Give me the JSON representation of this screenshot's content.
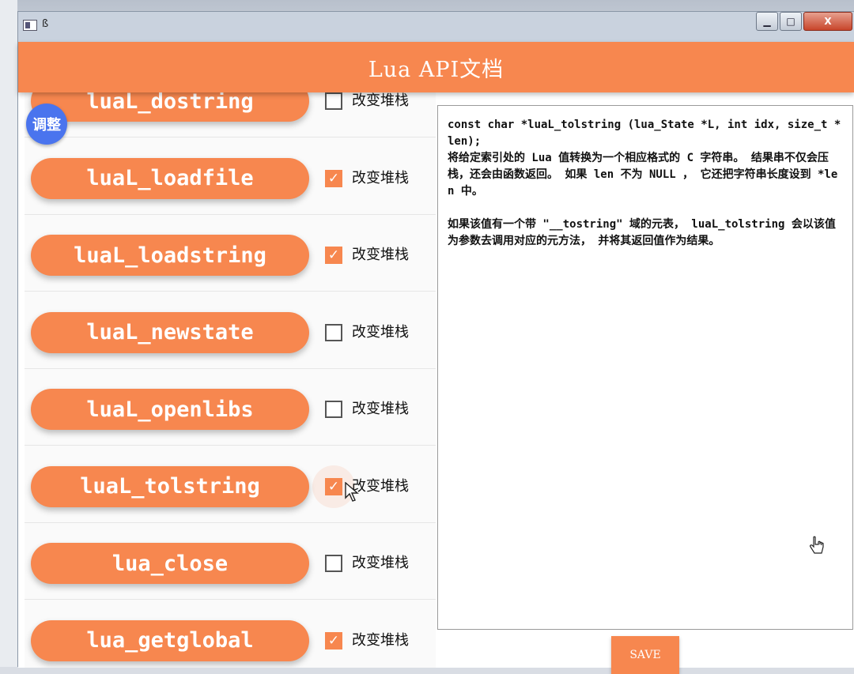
{
  "window": {
    "icon_glyph": "ß",
    "minimize": "▁",
    "maximize": "□",
    "close": "X"
  },
  "header": {
    "title": "Lua API文档"
  },
  "fab": {
    "label": "调整"
  },
  "list": {
    "items": [
      {
        "name": "luaL_dostring",
        "checked": false,
        "label": "改变堆栈"
      },
      {
        "name": "luaL_loadfile",
        "checked": true,
        "label": "改变堆栈"
      },
      {
        "name": "luaL_loadstring",
        "checked": true,
        "label": "改变堆栈"
      },
      {
        "name": "luaL_newstate",
        "checked": false,
        "label": "改变堆栈"
      },
      {
        "name": "luaL_openlibs",
        "checked": false,
        "label": "改变堆栈"
      },
      {
        "name": "luaL_tolstring",
        "checked": true,
        "label": "改变堆栈"
      },
      {
        "name": "lua_close",
        "checked": false,
        "label": "改变堆栈"
      },
      {
        "name": "lua_getglobal",
        "checked": true,
        "label": "改变堆栈"
      }
    ]
  },
  "doc": {
    "text": "const char *luaL_tolstring (lua_State *L, int idx, size_t *len);\n将给定索引处的 Lua 值转换为一个相应格式的 C 字符串。 结果串不仅会压栈，还会由函数返回。 如果 len 不为 NULL ， 它还把字符串长度设到 *len 中。\n\n如果该值有一个带 \"__tostring\" 域的元表， luaL_tolstring 会以该值为参数去调用对应的元方法， 并将其返回值作为结果。"
  },
  "save": {
    "label": "SAVE"
  },
  "icons": {
    "check": "✓",
    "pointer": "pointer-cursor-icon",
    "hand": "hand-cursor-icon"
  },
  "colors": {
    "accent": "#f7874f",
    "fab": "#4a74ee"
  }
}
